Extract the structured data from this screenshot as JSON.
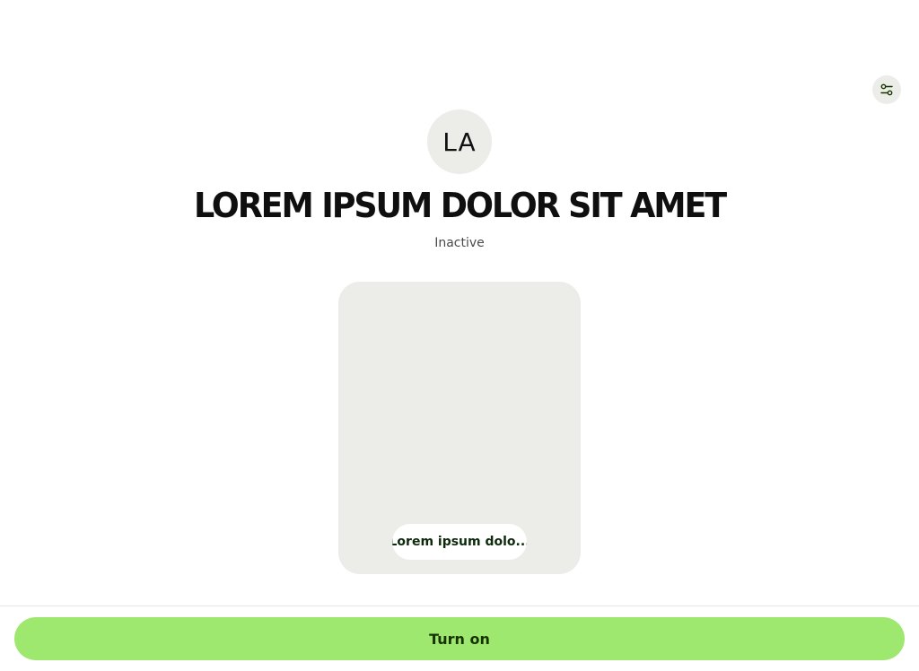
{
  "header": {
    "settings_icon": "sliders-icon"
  },
  "profile": {
    "initials": "LA",
    "title": "LOREM IPSUM DOLOR SIT AMET",
    "status": "Inactive"
  },
  "card": {
    "chip_label": "Lorem ipsum dolo..."
  },
  "footer": {
    "primary_label": "Turn on"
  },
  "colors": {
    "accent": "#9ee870",
    "accent_text": "#163300",
    "surface": "#ecede9"
  }
}
